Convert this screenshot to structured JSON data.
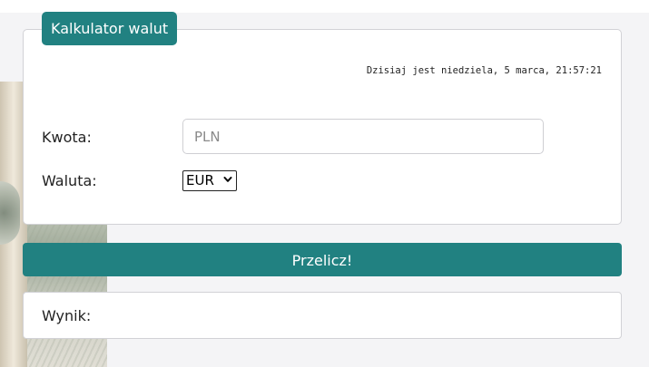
{
  "app": {
    "title": "Kalkulator walut",
    "accent_color": "#218181"
  },
  "header": {
    "datetime": "Dzisiaj jest niedziela, 5 marca, 21:57:21"
  },
  "form": {
    "amount_label": "Kwota:",
    "amount_placeholder": "PLN",
    "amount_value": "",
    "currency_label": "Waluta:",
    "currency_selected": "EUR"
  },
  "actions": {
    "convert_label": "Przelicz!"
  },
  "result": {
    "label": "Wynik:",
    "value": ""
  }
}
